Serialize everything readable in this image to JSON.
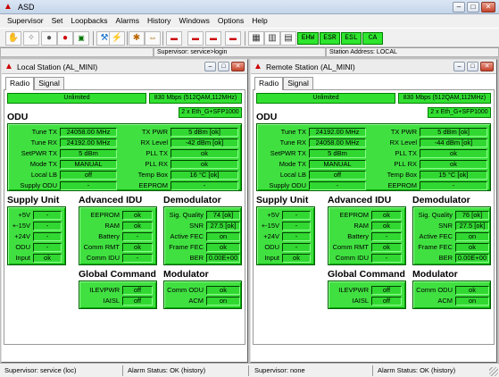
{
  "app": {
    "title": "ASD"
  },
  "menu": [
    "Supervisor",
    "Set",
    "Loopbacks",
    "Alarms",
    "History",
    "Windows",
    "Options",
    "Help"
  ],
  "toolbar": {
    "icons": [
      "hand-icon",
      "sparkle-icon",
      "stop-icon",
      "record-icon",
      "terminal-icon",
      "tools-icon",
      "network-icon",
      "star-icon",
      "wrench-icon",
      "transfer-icon",
      "module-red-icon",
      "module-red-icon",
      "module-red-icon",
      "module-red-icon",
      "grid-icon",
      "chart-icon",
      "table-icon"
    ],
    "alarms": [
      "EHW",
      "ESR",
      "ESL",
      "CA"
    ]
  },
  "status_top": {
    "supervisor": "Supervisor: service>login",
    "station": "Station Address: LOCAL"
  },
  "windows": [
    {
      "title": "Local Station (AL_MINI)",
      "tabs": [
        "Radio",
        "Signal"
      ],
      "bars": {
        "capacity": "Unlimited",
        "rate": "830 Mbps (512QAM,112MHz)",
        "eth": "2 x Eth_G+SFP1000"
      },
      "odu_title": "ODU",
      "odu_left": [
        {
          "label": "Tune TX",
          "value": "24058.00 MHz"
        },
        {
          "label": "Tune RX",
          "value": "24192.00 MHz"
        },
        {
          "label": "SetPWR TX",
          "value": "5 dBm"
        },
        {
          "label": "Mode TX",
          "value": "MANUAL"
        },
        {
          "label": "Local LB",
          "value": "off"
        },
        {
          "label": "Supply ODU",
          "value": "-"
        }
      ],
      "odu_right": [
        {
          "label": "TX PWR",
          "value": "5 dBm [ok]"
        },
        {
          "label": "RX Level",
          "value": "-42 dBm [ok]"
        },
        {
          "label": "PLL TX",
          "value": "ok"
        },
        {
          "label": "PLL RX",
          "value": "ok"
        },
        {
          "label": "Temp Box",
          "value": "16 °C [ok]"
        },
        {
          "label": "EEPROM",
          "value": "-"
        }
      ],
      "supply_title": "Supply Unit",
      "supply": [
        {
          "label": "+5V",
          "value": "-"
        },
        {
          "label": "+-15V",
          "value": "-"
        },
        {
          "label": "+24V",
          "value": "-"
        },
        {
          "label": "ODU",
          "value": "-"
        },
        {
          "label": "Input",
          "value": "ok"
        }
      ],
      "advidu_title": "Advanced IDU",
      "advidu": [
        {
          "label": "EEPROM",
          "value": "ok"
        },
        {
          "label": "RAM",
          "value": "ok"
        },
        {
          "label": "Battery",
          "value": "-"
        },
        {
          "label": "Comm RMT",
          "value": "ok"
        },
        {
          "label": "Comm IDU",
          "value": "-"
        }
      ],
      "demod_title": "Demodulator",
      "demod": [
        {
          "label": "Sig. Quality",
          "value": "74 [ok]"
        },
        {
          "label": "SNR",
          "value": "27.5 [ok]"
        },
        {
          "label": "Active FEC",
          "value": "on"
        },
        {
          "label": "Frame FEC",
          "value": "ok"
        },
        {
          "label": "BER",
          "value": "0.00E+00"
        }
      ],
      "global_title": "Global Command",
      "global": [
        {
          "label": "ILEVPWR",
          "value": "off"
        },
        {
          "label": "IAISL",
          "value": "off"
        }
      ],
      "mod_title": "Modulator",
      "mod": [
        {
          "label": "Comm ODU",
          "value": "ok"
        },
        {
          "label": "ACM",
          "value": "on"
        }
      ]
    },
    {
      "title": "Remote Station (AL_MINI)",
      "tabs": [
        "Radio",
        "Signal"
      ],
      "bars": {
        "capacity": "Unlimited",
        "rate": "830 Mbps (512QAM,112MHz)",
        "eth": "2 x Eth_G+SFP1000"
      },
      "odu_title": "ODU",
      "odu_left": [
        {
          "label": "Tune TX",
          "value": "24192.00 MHz"
        },
        {
          "label": "Tune RX",
          "value": "24058.00 MHz"
        },
        {
          "label": "SetPWR TX",
          "value": "5 dBm"
        },
        {
          "label": "Mode TX",
          "value": "MANUAL"
        },
        {
          "label": "Local LB",
          "value": "off"
        },
        {
          "label": "Supply ODU",
          "value": "-"
        }
      ],
      "odu_right": [
        {
          "label": "TX PWR",
          "value": "5 dBm [ok]"
        },
        {
          "label": "RX Level",
          "value": "-44 dBm [ok]"
        },
        {
          "label": "PLL TX",
          "value": "ok"
        },
        {
          "label": "PLL RX",
          "value": "ok"
        },
        {
          "label": "Temp Box",
          "value": "15 °C [ok]"
        },
        {
          "label": "EEPROM",
          "value": "-"
        }
      ],
      "supply_title": "Supply Unit",
      "supply": [
        {
          "label": "+5V",
          "value": "-"
        },
        {
          "label": "+-15V",
          "value": "-"
        },
        {
          "label": "+24V",
          "value": "-"
        },
        {
          "label": "ODU",
          "value": "-"
        },
        {
          "label": "Input",
          "value": "ok"
        }
      ],
      "advidu_title": "Advanced IDU",
      "advidu": [
        {
          "label": "EEPROM",
          "value": "ok"
        },
        {
          "label": "RAM",
          "value": "ok"
        },
        {
          "label": "Battery",
          "value": "-"
        },
        {
          "label": "Comm RMT",
          "value": "ok"
        },
        {
          "label": "Comm IDU",
          "value": "-"
        }
      ],
      "demod_title": "Demodulator",
      "demod": [
        {
          "label": "Sig. Quality",
          "value": "76 [ok]"
        },
        {
          "label": "SNR",
          "value": "27.5 [ok]"
        },
        {
          "label": "Active FEC",
          "value": "on"
        },
        {
          "label": "Frame FEC",
          "value": "ok"
        },
        {
          "label": "BER",
          "value": "0.00E+00"
        }
      ],
      "global_title": "Global Command",
      "global": [
        {
          "label": "ILEVPWR",
          "value": "off"
        },
        {
          "label": "IAISL",
          "value": "off"
        }
      ],
      "mod_title": "Modulator",
      "mod": [
        {
          "label": "Comm ODU",
          "value": "ok"
        },
        {
          "label": "ACM",
          "value": "on"
        }
      ]
    }
  ],
  "bottom": [
    {
      "left": "Supervisor: service (loc)",
      "right": "Alarm Status: OK (history)"
    },
    {
      "left": "Supervisor: none",
      "right": "Alarm Status: OK (history)"
    }
  ],
  "colors": {
    "green": "#32e032",
    "alarm_green": "#2ee62e",
    "dark_green": "#006000"
  }
}
